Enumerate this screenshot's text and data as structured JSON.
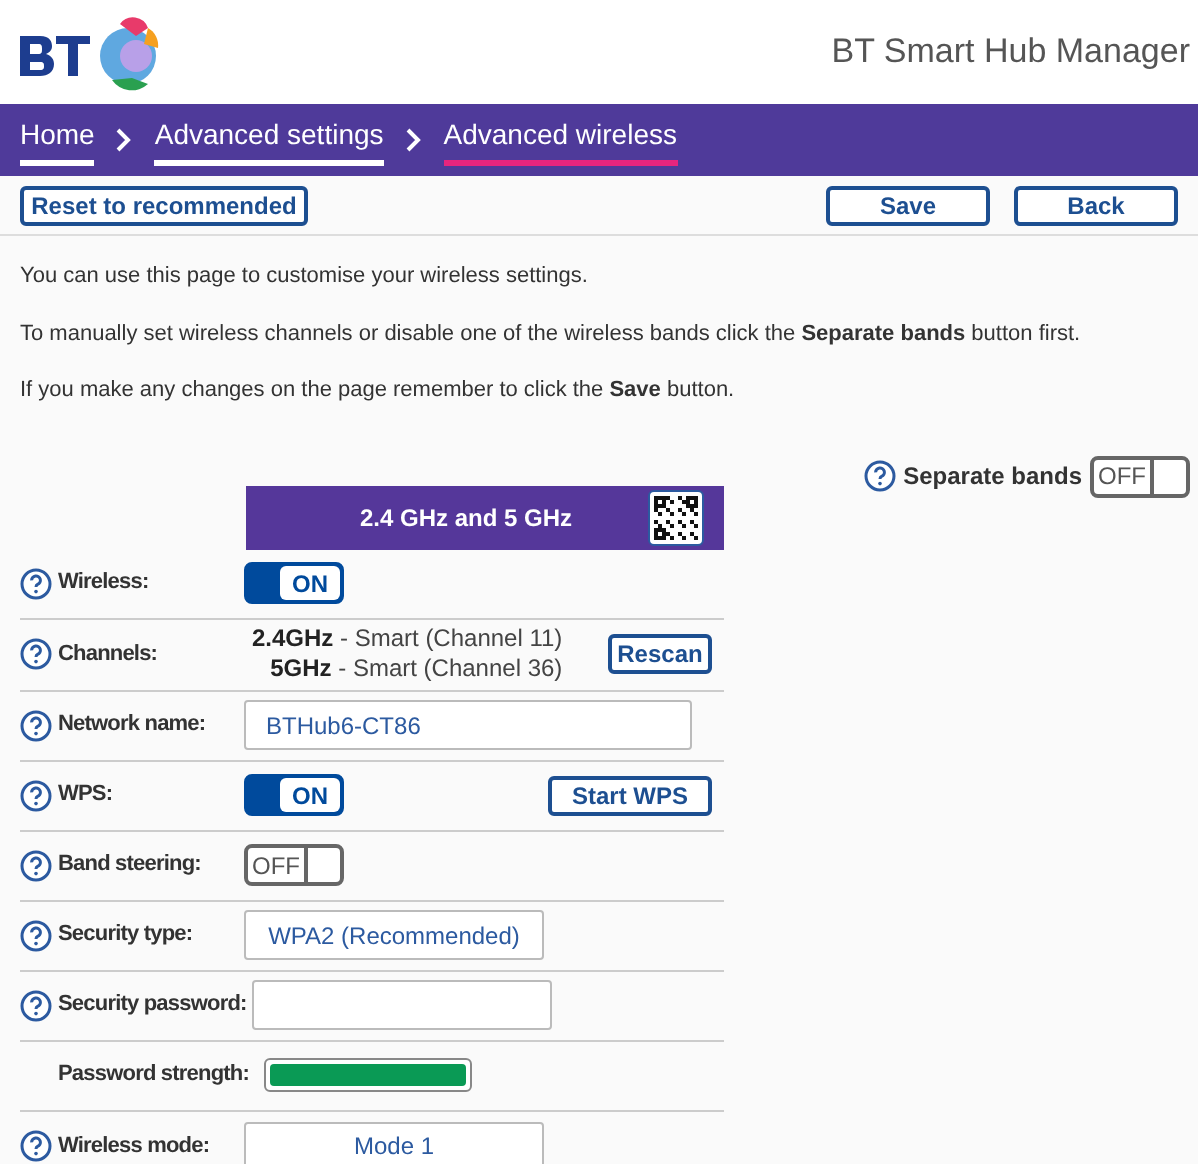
{
  "header": {
    "title": "BT Smart Hub Manager"
  },
  "breadcrumbs": [
    {
      "label": "Home",
      "selected": false
    },
    {
      "label": "Advanced settings",
      "selected": false
    },
    {
      "label": "Advanced wireless",
      "selected": true
    }
  ],
  "toolbar": {
    "reset": "Reset to recommended",
    "save": "Save",
    "back": "Back"
  },
  "intro": [
    "You can use this page to customise your wireless settings.",
    "To manually set wireless channels or disable one of the wireless bands click the **Separate bands** button first.",
    "If you make any changes on the page remember to click the **Save** button."
  ],
  "separate_bands": {
    "label": "Separate bands",
    "on": false,
    "text": "OFF"
  },
  "band_header": "2.4 GHz and 5 GHz",
  "rows": [
    {
      "kind": "toggle",
      "label": "Wireless:",
      "help": true,
      "on": true,
      "text": "ON"
    },
    {
      "kind": "channels",
      "label": "Channels:",
      "help": true,
      "channels": [
        {
          "band": "2.4GHz",
          "value": " - Smart (Channel 11)"
        },
        {
          "band": "5GHz",
          "value": " - Smart (Channel 36)"
        }
      ],
      "button": "Rescan"
    },
    {
      "kind": "input",
      "label": "Network name:",
      "help": true,
      "value": "BTHub6-CT86"
    },
    {
      "kind": "toggle",
      "label": "WPS:",
      "help": true,
      "on": true,
      "text": "ON",
      "button": "Start WPS"
    },
    {
      "kind": "toggle",
      "label": "Band steering:",
      "help": true,
      "on": false,
      "text": "OFF"
    },
    {
      "kind": "select",
      "label": "Security type:",
      "help": true,
      "value": "WPA2 (Recommended)"
    },
    {
      "kind": "input",
      "label": "Security password:",
      "help": true,
      "value": ""
    },
    {
      "kind": "strength",
      "label": "Password strength:",
      "help": false,
      "level": 1
    },
    {
      "kind": "select",
      "label": "Wireless mode:",
      "help": true,
      "value": "Mode 1"
    }
  ]
}
